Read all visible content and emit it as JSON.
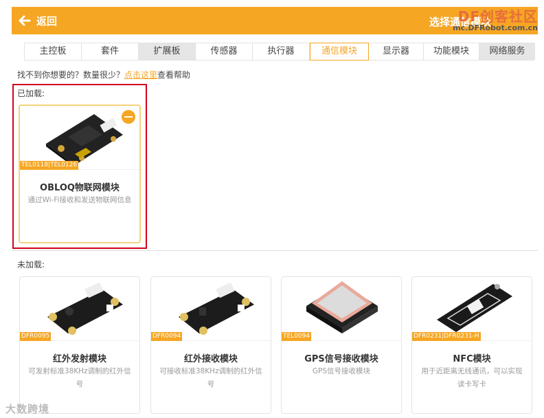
{
  "header": {
    "back_label": "返回",
    "title": "选择通信模块",
    "watermark_line1": "DF创客社区",
    "watermark_line2": "mc.DFRobot.com.cn",
    "bg_color": "#f5a623"
  },
  "tabs": [
    {
      "label": "主控板"
    },
    {
      "label": "套件"
    },
    {
      "label": "扩展板"
    },
    {
      "label": "传感器"
    },
    {
      "label": "执行器"
    },
    {
      "label": "通信模块",
      "active": true
    },
    {
      "label": "显示器"
    },
    {
      "label": "功能模块"
    },
    {
      "label": "网络服务"
    }
  ],
  "help": {
    "prefix": "找不到你想要的？数量很少？",
    "link": "点击这里",
    "suffix": "查看帮助"
  },
  "loaded": {
    "label": "已加载:",
    "cards": [
      {
        "sku": "TEL0118|TEL0126",
        "name": "OBLOQ物联网模块",
        "desc": "通过Wi-Fi接收和发送物联网信息"
      }
    ]
  },
  "unloaded": {
    "label": "未加载:",
    "cards": [
      {
        "sku": "DFR0095",
        "name": "红外发射模块",
        "desc": "可发射标准38KHz调制的红外信号"
      },
      {
        "sku": "DFR0094",
        "name": "红外接收模块",
        "desc": "可接收标准38KHz调制的红外信号"
      },
      {
        "sku": "TEL0094",
        "name": "GPS信号接收模块",
        "desc": "GPS信号接收模块"
      },
      {
        "sku": "DFR0231|DFR0231-H",
        "name": "NFC模块",
        "desc": "用于近距离无线通讯，可以实现读卡写卡"
      }
    ]
  },
  "watermark_bottom": "大数跨境",
  "accent_color": "#f5a623"
}
